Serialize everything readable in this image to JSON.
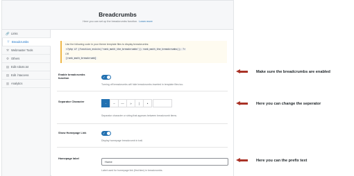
{
  "header": {
    "title": "Breadcrumbs",
    "description": "Here you can set up the breadcrumbs function.",
    "learn_more": "Learn more"
  },
  "sidebar": {
    "items": [
      {
        "label": "Links",
        "icon": "link-icon",
        "glyph": "🔗"
      },
      {
        "label": "Breadcrumbs",
        "icon": "breadcrumbs-icon",
        "glyph": "⊤",
        "active": true
      },
      {
        "label": "Webmaster Tools",
        "icon": "webmaster-tools-icon",
        "glyph": "⚒"
      },
      {
        "label": "Others",
        "icon": "others-icon",
        "glyph": "⚙"
      },
      {
        "label": "Edit robots.txt",
        "icon": "robots-icon",
        "glyph": "▤"
      },
      {
        "label": "Edit .htaccess",
        "icon": "htaccess-icon",
        "glyph": "▤"
      },
      {
        "label": "Analytics",
        "icon": "analytics-icon",
        "glyph": "▥"
      }
    ]
  },
  "notice": {
    "text": "Use the following code in your theme template files to display breadcrumbs:",
    "code": "<?php if (function_exists('rank_math_the_breadcrumbs')) rank_math_the_breadcrumbs(); ?>",
    "or": "OR",
    "shortcode": "[rank_math_breadcrumb]"
  },
  "settings": {
    "enable": {
      "label": "Enable breadcrumbs function",
      "description": "Turning off breadcrumbs will hide breadcrumbs inserted in template files too.",
      "enabled": true
    },
    "separator": {
      "label": "Separator Character",
      "description": "Separator character or string that appears between breadcrumb items.",
      "options": [
        "-",
        "–",
        "—",
        "»",
        "|",
        "•"
      ],
      "selected_index": 0,
      "custom_value": ""
    },
    "show_homepage": {
      "label": "Show Homepage Link",
      "description": "Display homepage breadcrumb in trail.",
      "enabled": true
    },
    "homepage_label": {
      "label": "Homepage label",
      "value": "Home",
      "description": "Label used for homepage link (first item) in breadcrumbs."
    }
  },
  "annotations": [
    "Make sure the breadcrumbs are enabled",
    "Here you can change the seperator",
    "Here you can the prefix text"
  ],
  "colors": {
    "accent": "#2271b1",
    "annotation_arrow": "#a93226",
    "notice_border": "#f0b849"
  }
}
